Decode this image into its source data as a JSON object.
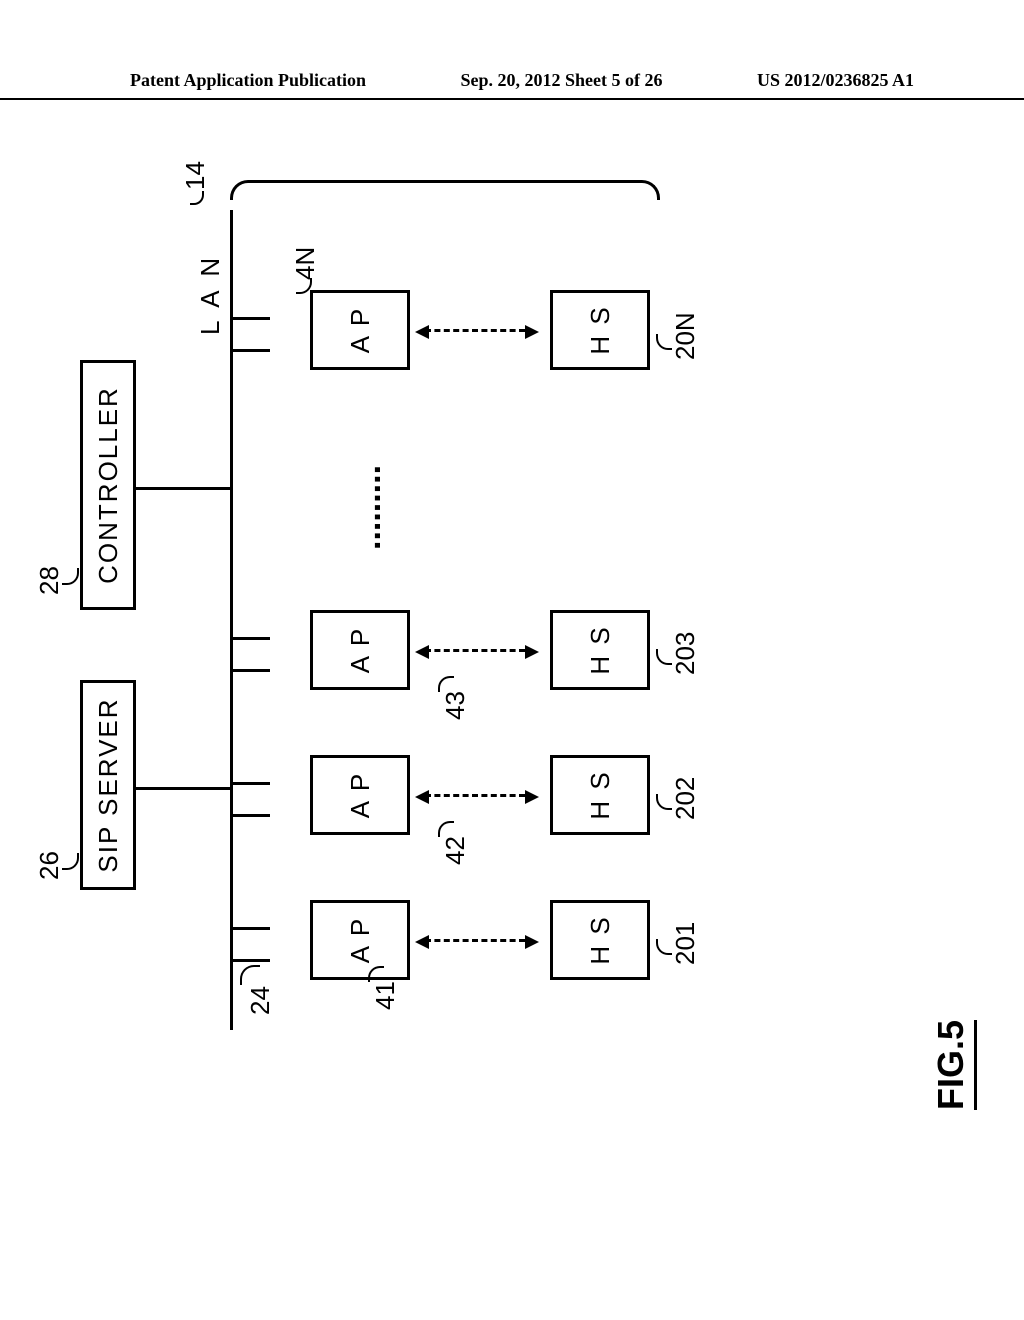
{
  "header": {
    "left": "Patent Application Publication",
    "center": "Sep. 20, 2012  Sheet 5 of 26",
    "right": "US 2012/0236825 A1"
  },
  "figure": {
    "label": "FIG.5",
    "lan_label": "L A N",
    "servers": {
      "sip": {
        "label": "SIP SERVER",
        "ref": "26"
      },
      "controller": {
        "label": "CONTROLLER",
        "ref": "28"
      }
    },
    "lan_ref": "24",
    "group_ref": "14",
    "aps": [
      {
        "label": "A P",
        "ref": "41"
      },
      {
        "label": "A P",
        "ref": "42"
      },
      {
        "label": "A P",
        "ref": "43"
      },
      {
        "label": "A P",
        "ref": "4N"
      }
    ],
    "hs": [
      {
        "label": "H S",
        "ref": "201"
      },
      {
        "label": "H S",
        "ref": "202"
      },
      {
        "label": "H S",
        "ref": "203"
      },
      {
        "label": "H S",
        "ref": "20N"
      }
    ],
    "ellipsis": "........."
  }
}
